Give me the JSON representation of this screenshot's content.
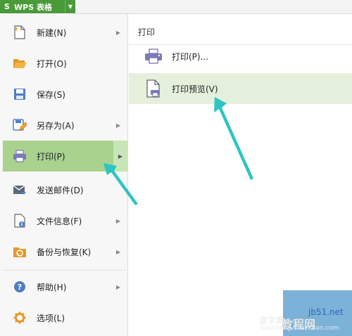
{
  "app": {
    "title": "WPS 表格",
    "logo": "S",
    "dropdown_icon": "triangle-down-icon",
    "accent": "#4a9a3a"
  },
  "menu": {
    "items": [
      {
        "label": "新建(N)",
        "icon": "new-file-icon",
        "has_submenu": true
      },
      {
        "label": "打开(O)",
        "icon": "folder-open-icon",
        "has_submenu": false
      },
      {
        "label": "保存(S)",
        "icon": "save-disk-icon",
        "has_submenu": false
      },
      {
        "label": "另存为(A)",
        "icon": "save-as-icon",
        "has_submenu": true
      },
      {
        "label": "打印(P)",
        "icon": "printer-icon",
        "has_submenu": true,
        "selected": true
      },
      {
        "label": "发送邮件(D)",
        "icon": "mail-icon",
        "has_submenu": false
      },
      {
        "label": "文件信息(F)",
        "icon": "file-info-icon",
        "has_submenu": true
      },
      {
        "label": "备份与恢复(K)",
        "icon": "backup-icon",
        "has_submenu": true
      },
      {
        "label": "帮助(H)",
        "icon": "help-icon",
        "has_submenu": true
      },
      {
        "label": "选项(L)",
        "icon": "gear-icon",
        "has_submenu": false
      }
    ],
    "selected_color": "#a8d28e"
  },
  "panel": {
    "title": "打印",
    "items": [
      {
        "label": "打印(P)...",
        "icon": "printer-icon"
      },
      {
        "label": "打印预览(V)",
        "icon": "print-preview-icon",
        "highlighted": true
      }
    ],
    "highlight_color": "#e4f0dc"
  },
  "watermark": {
    "site": "jb51.net",
    "name": "教程网",
    "prefix": "查字典",
    "url": "jiaocheng.chazidian.com"
  },
  "annotation_color": "#2ec4c4"
}
